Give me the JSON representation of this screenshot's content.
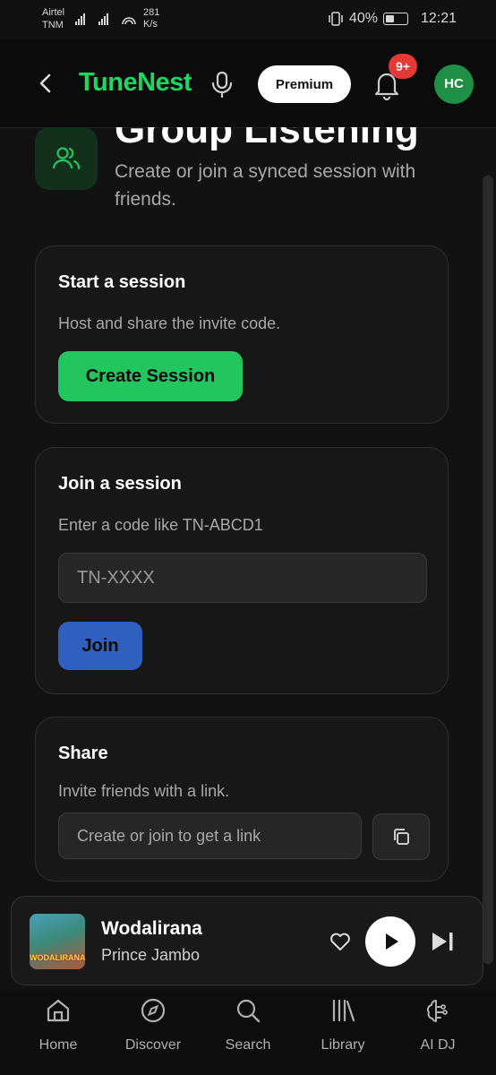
{
  "status_bar": {
    "carrier_line1": "Airtel",
    "carrier_line2": "TNM",
    "net_speed_value": "281",
    "net_speed_unit": "K/s",
    "battery": "40%",
    "time": "12:21"
  },
  "app_bar": {
    "logo": "TuneNest",
    "premium_label": "Premium",
    "notification_badge": "9+",
    "avatar_initials": "HC"
  },
  "page": {
    "title": "Group Listening",
    "subtitle": "Create or join a synced session with friends."
  },
  "start_session": {
    "title": "Start a session",
    "description": "Host and share the invite code.",
    "button_label": "Create Session"
  },
  "join_session": {
    "title": "Join a session",
    "description": "Enter a code like TN-ABCD1",
    "input_placeholder": "TN-XXXX",
    "button_label": "Join"
  },
  "share": {
    "title": "Share",
    "description": "Invite friends with a link.",
    "link_placeholder": "Create or join to get a link",
    "copy_icon": "copy-icon"
  },
  "now_playing": {
    "track_title": "Wodalirana",
    "artist": "Prince Jambo",
    "art_text": "WODALIRANA"
  },
  "bottom_nav": {
    "items": [
      {
        "label": "Home",
        "icon": "home-icon"
      },
      {
        "label": "Discover",
        "icon": "compass-icon"
      },
      {
        "label": "Search",
        "icon": "search-icon"
      },
      {
        "label": "Library",
        "icon": "library-icon"
      },
      {
        "label": "AI DJ",
        "icon": "brain-icon"
      }
    ]
  },
  "colors": {
    "accent_green": "#22c55e",
    "join_blue": "#2f5fbf",
    "badge_red": "#e53935",
    "background": "#121212"
  }
}
